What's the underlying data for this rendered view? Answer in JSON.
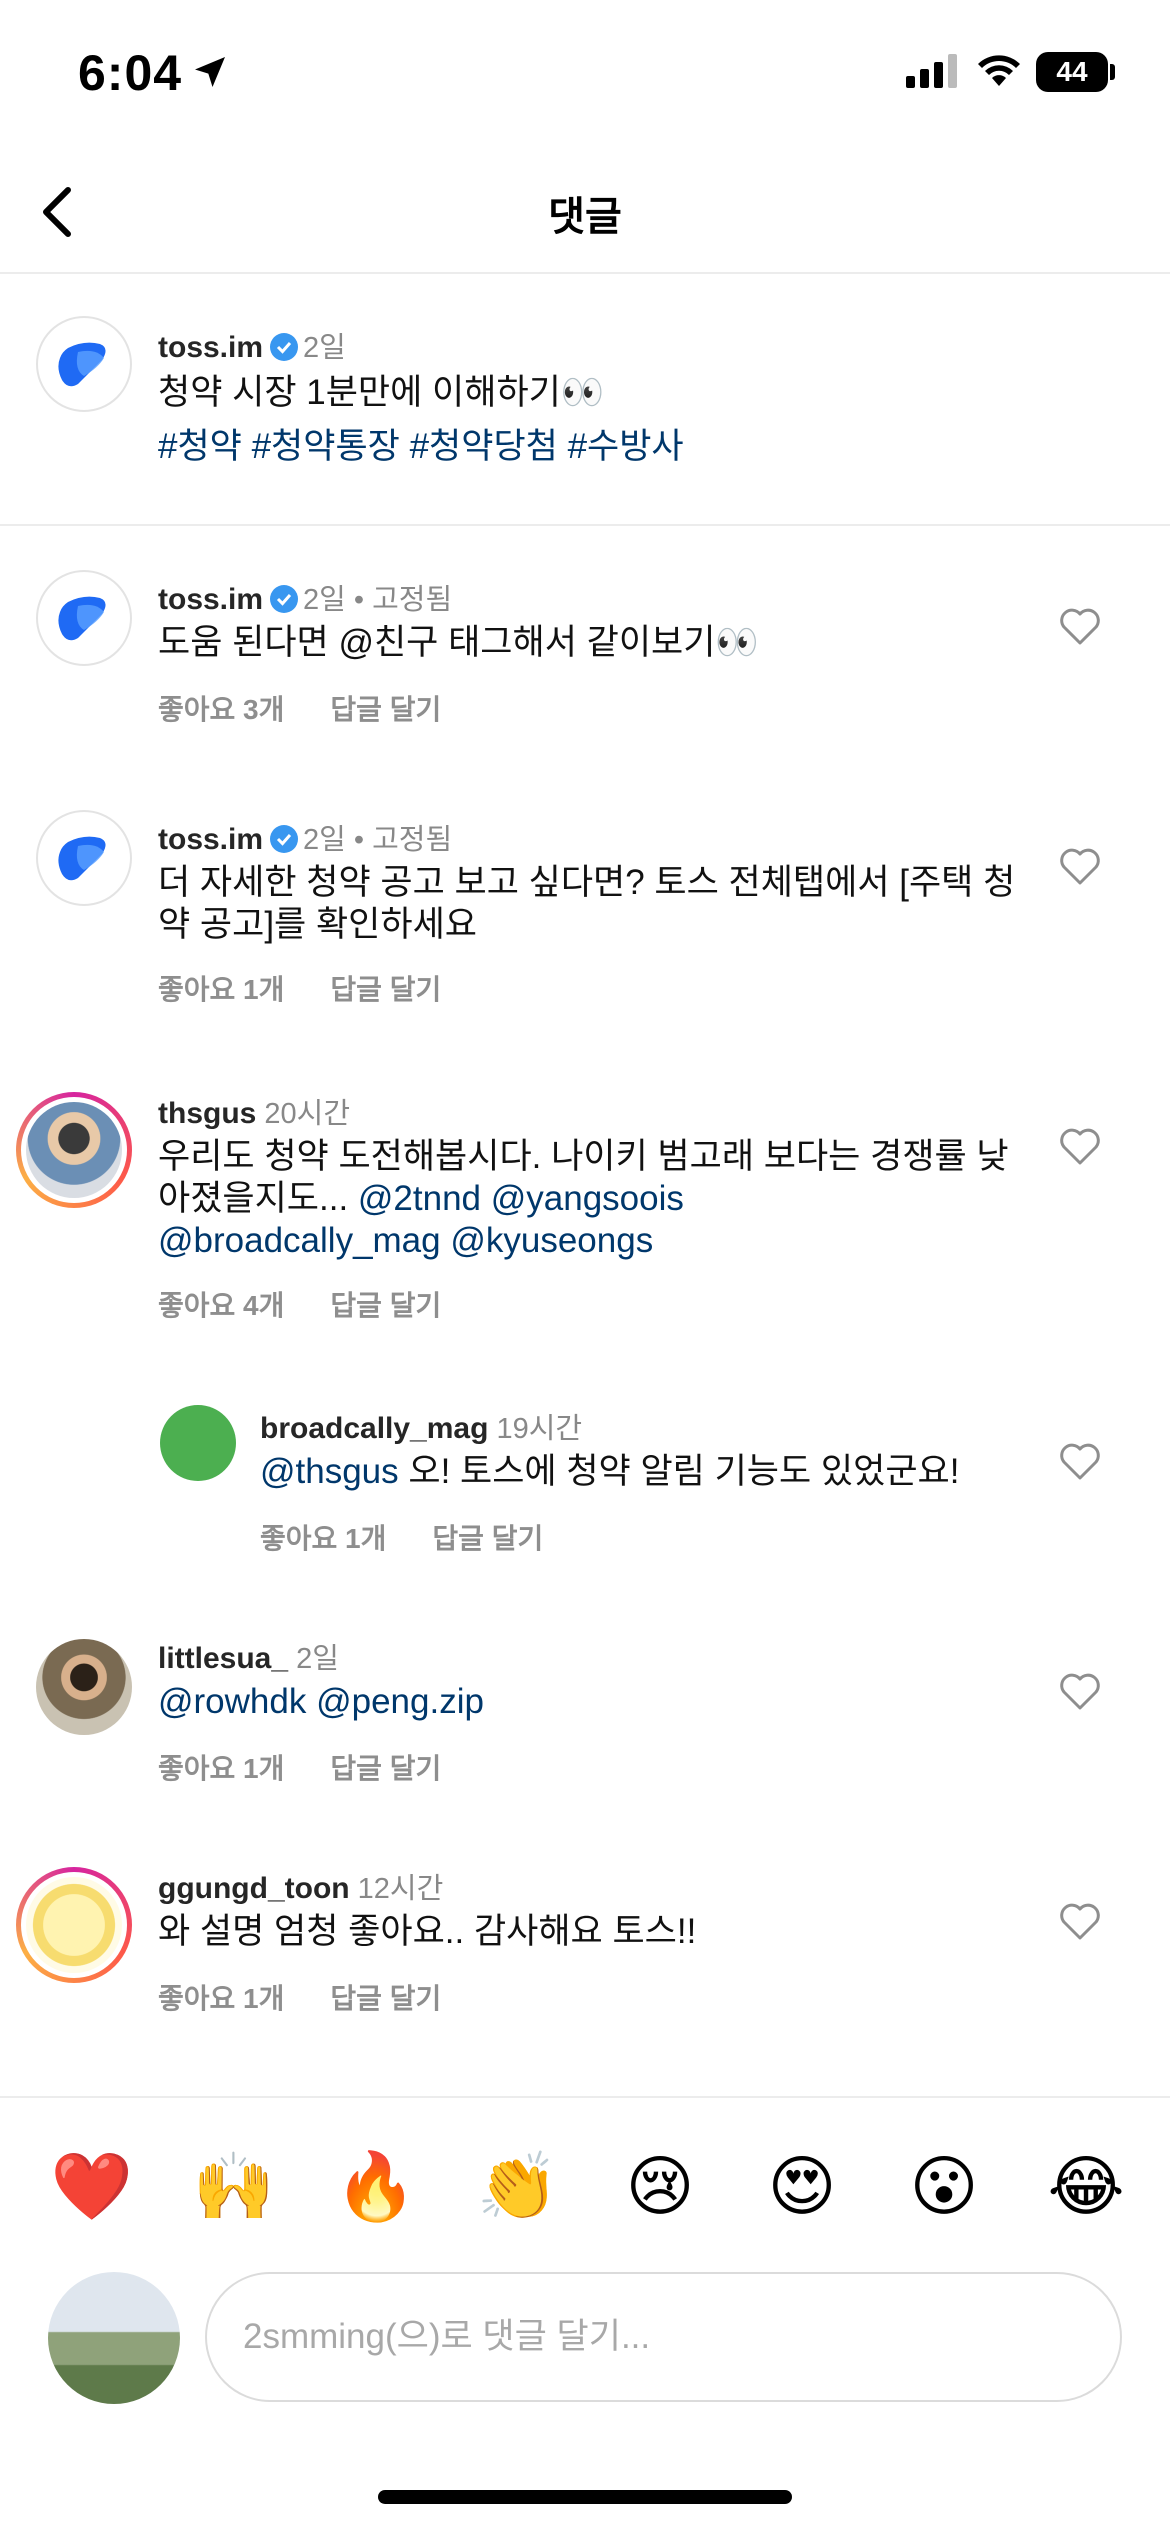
{
  "status_bar": {
    "time": "6:04",
    "battery": "44"
  },
  "header": {
    "title": "댓글"
  },
  "caption": {
    "username": "toss.im",
    "time": "2일",
    "text": "청약 시장 1분만에 이해하기👀",
    "hashtags": "#청약 #청약통장 #청약당첨 #수방사"
  },
  "comments": [
    {
      "username": "toss.im",
      "time": "2일",
      "pinned": "• 고정됨",
      "text_line1": "도움 된다면 @친구 태그해서 같이보기👀",
      "likes": "좋아요 3개",
      "reply": "답글 달기"
    },
    {
      "username": "toss.im",
      "time": "2일",
      "pinned": "• 고정됨",
      "text_line1": "더 자세한 청약 공고 보고 싶다면? 토스 전체탭에서 [주택 청",
      "text_line2": "약 공고]를 확인하세요",
      "likes": "좋아요 1개",
      "reply": "답글 달기"
    },
    {
      "username": "thsgus",
      "time": "20시간",
      "text_line1": "우리도 청약 도전해봅시다. 나이키 범고래 보다는 경쟁률 낮",
      "text_line2_plain": "아졌을지도... ",
      "mentions_line2": "@2tnnd @yangsoois",
      "mentions_line3": "@broadcally_mag @kyuseongs",
      "likes": "좋아요 4개",
      "reply": "답글 달기"
    },
    {
      "username": "broadcally_mag",
      "time": "19시간",
      "mention": "@thsgus",
      "text": " 오! 토스에 청약 알림 기능도 있었군요!",
      "likes": "좋아요 1개",
      "reply": "답글 달기"
    },
    {
      "username": "littlesua_",
      "time": "2일",
      "mentions": "@rowhdk @peng.zip",
      "likes": "좋아요 1개",
      "reply": "답글 달기"
    },
    {
      "username": "ggungd_toon",
      "time": "12시간",
      "text": "와 설명 엄청 좋아요.. 감사해요 토스!!",
      "likes": "좋아요 1개",
      "reply": "답글 달기"
    }
  ],
  "emoji_bar": [
    "❤️",
    "🙌",
    "🔥",
    "👏",
    "😢",
    "😍",
    "😮",
    "😂"
  ],
  "input": {
    "placeholder": "2smming(으)로 댓글 달기..."
  },
  "colors": {
    "mention": "#00376b",
    "verified": "#3897f0",
    "toss_blue": "#1f6af4"
  }
}
